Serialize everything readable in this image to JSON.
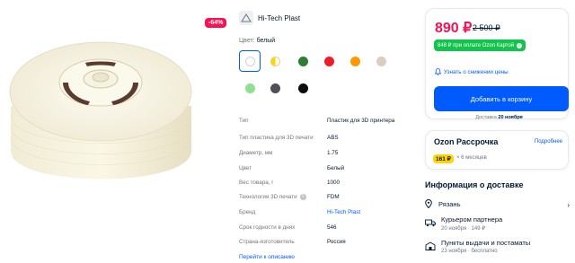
{
  "product": {
    "discount": "-64%",
    "brand": "Hi-Tech Plast",
    "color_label": "Цвет:",
    "color_value": "белый",
    "swatches": [
      {
        "name": "белый",
        "color": "#ffffff",
        "selected": true
      },
      {
        "name": "желтый/белый",
        "color": "#ffd400",
        "selected": false
      },
      {
        "name": "зеленый",
        "color": "#2e7d32",
        "selected": false
      },
      {
        "name": "красный",
        "color": "#ee1c25",
        "selected": false
      },
      {
        "name": "оранжевый",
        "color": "#ff9900",
        "selected": false
      },
      {
        "name": "бежевый",
        "color": "#dccdc1",
        "selected": false
      },
      {
        "name": "светло-зеленый",
        "color": "#8fe08f",
        "selected": false
      },
      {
        "name": "серый",
        "color": "#4d5056",
        "selected": false
      },
      {
        "name": "черный",
        "color": "#0c0c0c",
        "selected": false
      }
    ],
    "specs": [
      {
        "key": "Тип",
        "value": "Пластик для 3D принтера"
      },
      {
        "key": "Тип пластика для 3D печати",
        "value": "ABS"
      },
      {
        "key": "Диаметр, мм",
        "value": "1.75"
      },
      {
        "key": "Цвет",
        "value": "Белый"
      },
      {
        "key": "Вес товара, г",
        "value": "1000"
      },
      {
        "key": "Технология 3D печати",
        "value": "FDM",
        "info": true
      },
      {
        "key": "Бренд",
        "value": "Hi-Tech Plast",
        "link": true
      },
      {
        "key": "Срок годности в днях",
        "value": "546"
      },
      {
        "key": "Страна-изготовитель",
        "value": "Россия"
      }
    ],
    "description_link": "Перейти к описанию"
  },
  "price_card": {
    "price": "890 ₽",
    "old_price": "2 500 ₽",
    "ozon_card_price": "848 ₽ при оплате Ozon Картой",
    "notify_label": "Узнать о снижении цены",
    "cart_button": "Добавить в корзину",
    "delivery_note_prefix": "Доставка",
    "delivery_note_date": "20 ноября"
  },
  "installment": {
    "title": "Ozon Рассрочка",
    "more": "Подробнее",
    "price": "161 ₽",
    "months": "× 6 месяцев"
  },
  "delivery": {
    "title": "Информация о доставке",
    "city": "Рязань",
    "options": [
      {
        "title": "Курьером партнера",
        "subtitle": "20 ноября · 149 ₽",
        "icon": "courier-icon"
      },
      {
        "title": "Пункты выдачи и постаматы",
        "subtitle": "23 ноября · бесплатно",
        "icon": "pickup-point-icon"
      }
    ]
  },
  "colors": {
    "accent": "#005bff",
    "price": "#f91155",
    "ozon_card": "#10c44c",
    "installment_badge": "#ffd400"
  }
}
